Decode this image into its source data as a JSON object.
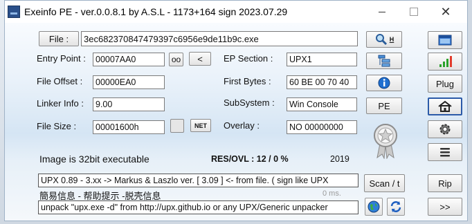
{
  "window": {
    "title": "Exeinfo PE - ver.0.0.8.1  by A.S.L -  1173+164 sign  2023.07.29",
    "close_glyph": "✕"
  },
  "file": {
    "button_label": "File :",
    "path": "3ec682370847479397c6956e9de11b9c.exe"
  },
  "entry_point": {
    "label": "Entry Point :",
    "value": "00007AA0",
    "oo_label": "oo",
    "arrow_label": "<"
  },
  "file_offset": {
    "label": "File Offset :",
    "value": "00000EA0"
  },
  "linker_info": {
    "label": "Linker Info :",
    "value": "9.00"
  },
  "file_size": {
    "label": "File Size :",
    "value": "00001600h",
    "net_label": "NET"
  },
  "ep_section": {
    "label": "EP Section :",
    "value": "UPX1"
  },
  "first_bytes": {
    "label": "First Bytes :",
    "value": "60 BE 00 70 40"
  },
  "subsystem": {
    "label": "SubSystem :",
    "value": "Win Console"
  },
  "overlay": {
    "label": "Overlay :",
    "value": "NO  00000000"
  },
  "info_row": {
    "image_bits": "Image is 32bit executable",
    "res_ovl": "RES/OVL : 12 / 0 %",
    "year": "2019"
  },
  "detection": {
    "line1": "UPX 0.89 - 3.xx -> Markus & Laszlo ver. [ 3.09 ] <- from file. ( sign like UPX",
    "help_text": "簡易信息 - 帮助提示 -脱壳信息",
    "ms": "0 ms.",
    "line2": "unpack \"upx.exe -d\"  from  http://upx.github.io or any UPX/Generic unpacker"
  },
  "center_buttons": {
    "search_h_label": "H",
    "pe_label": "PE",
    "scan_label": "Scan / t"
  },
  "right_buttons": {
    "plug_label": "Plug",
    "rip_label": "Rip",
    "next_label": ">>"
  },
  "colors": {
    "accent": "#2b5aa8",
    "window_border": "#9fb2c6"
  }
}
